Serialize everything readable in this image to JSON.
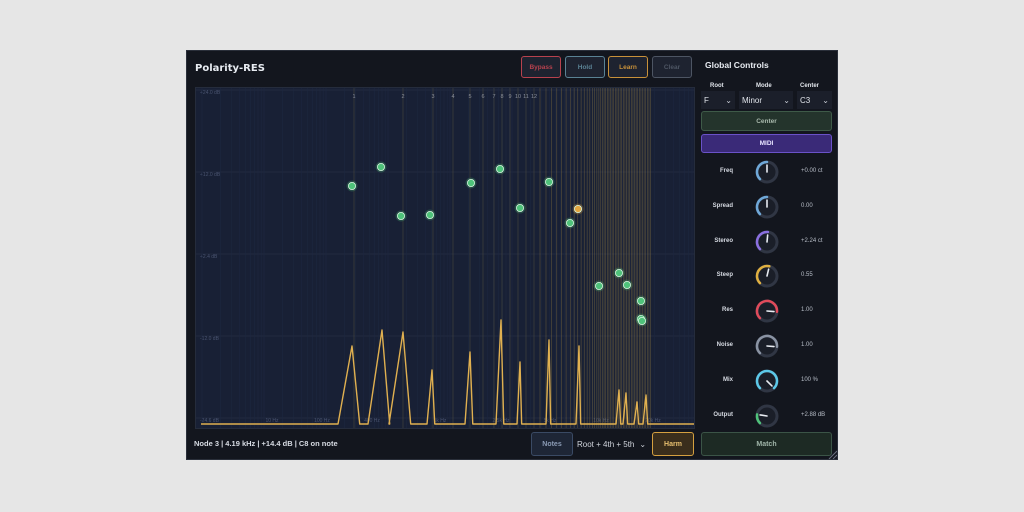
{
  "app": {
    "title": "Polarity-RES"
  },
  "toolbar": {
    "buttons": [
      {
        "label": "Bypass",
        "color": "#b8424e"
      },
      {
        "label": "Hold",
        "color": "#5a8294"
      },
      {
        "label": "Learn",
        "color": "#c8913a"
      },
      {
        "label": "Clear",
        "color": "#4d5563"
      }
    ]
  },
  "plot": {
    "y_ticks": [
      "+24.0 dB",
      "+12.0 dB",
      "+2.4 dB",
      "-12.0 dB",
      "-24.6 dB"
    ],
    "x_ticks": [
      "10 Hz",
      "100 Hz",
      "400 Hz",
      "1k Hz",
      "2.5k Hz",
      "5k Hz",
      "10k Hz",
      "20k Hz"
    ],
    "partials": [
      "1",
      "2",
      "3",
      "4",
      "5",
      "6",
      "7",
      "8",
      "9",
      "10",
      "11",
      "12"
    ],
    "node_color": "#4fc27a",
    "selected_node_color": "#e0a540",
    "curve_color": "#e0b050"
  },
  "status": "Node 3  |  4.19 kHz  |  +14.4 dB  |  C8 on note",
  "bottom": {
    "notes_label": "Notes",
    "harm_select": "Root + 4th + 5th",
    "harm_label": "Harm",
    "match_label": "Match"
  },
  "global": {
    "title": "Global Controls",
    "root_label": "Root",
    "root_value": "F",
    "mode_label": "Mode",
    "mode_value": "Minor",
    "center_label": "Center",
    "center_value": "C3",
    "center_button": "Center",
    "midi_button": "MIDI",
    "knobs": [
      {
        "label": "Freq",
        "value": "+0.00 ct",
        "color": "#6fa8d8",
        "level": 0.5
      },
      {
        "label": "Spread",
        "value": "0.00",
        "color": "#6fa8d8",
        "level": 0.5
      },
      {
        "label": "Stereo",
        "value": "+2.24 ct",
        "color": "#8a6fe0",
        "level": 0.52
      },
      {
        "label": "Steep",
        "value": "0.55",
        "color": "#e0b040",
        "level": 0.55
      },
      {
        "label": "Res",
        "value": "1.00",
        "color": "#e04a5a",
        "level": 0.85
      },
      {
        "label": "Noise",
        "value": "1.00",
        "color": "#8a93a3",
        "level": 0.85
      },
      {
        "label": "Mix",
        "value": "100 %",
        "color": "#5cc8e8",
        "level": 1.0
      },
      {
        "label": "Output",
        "value": "+2.88 dB",
        "color": "#4fc27a",
        "level": 0.2
      }
    ]
  }
}
